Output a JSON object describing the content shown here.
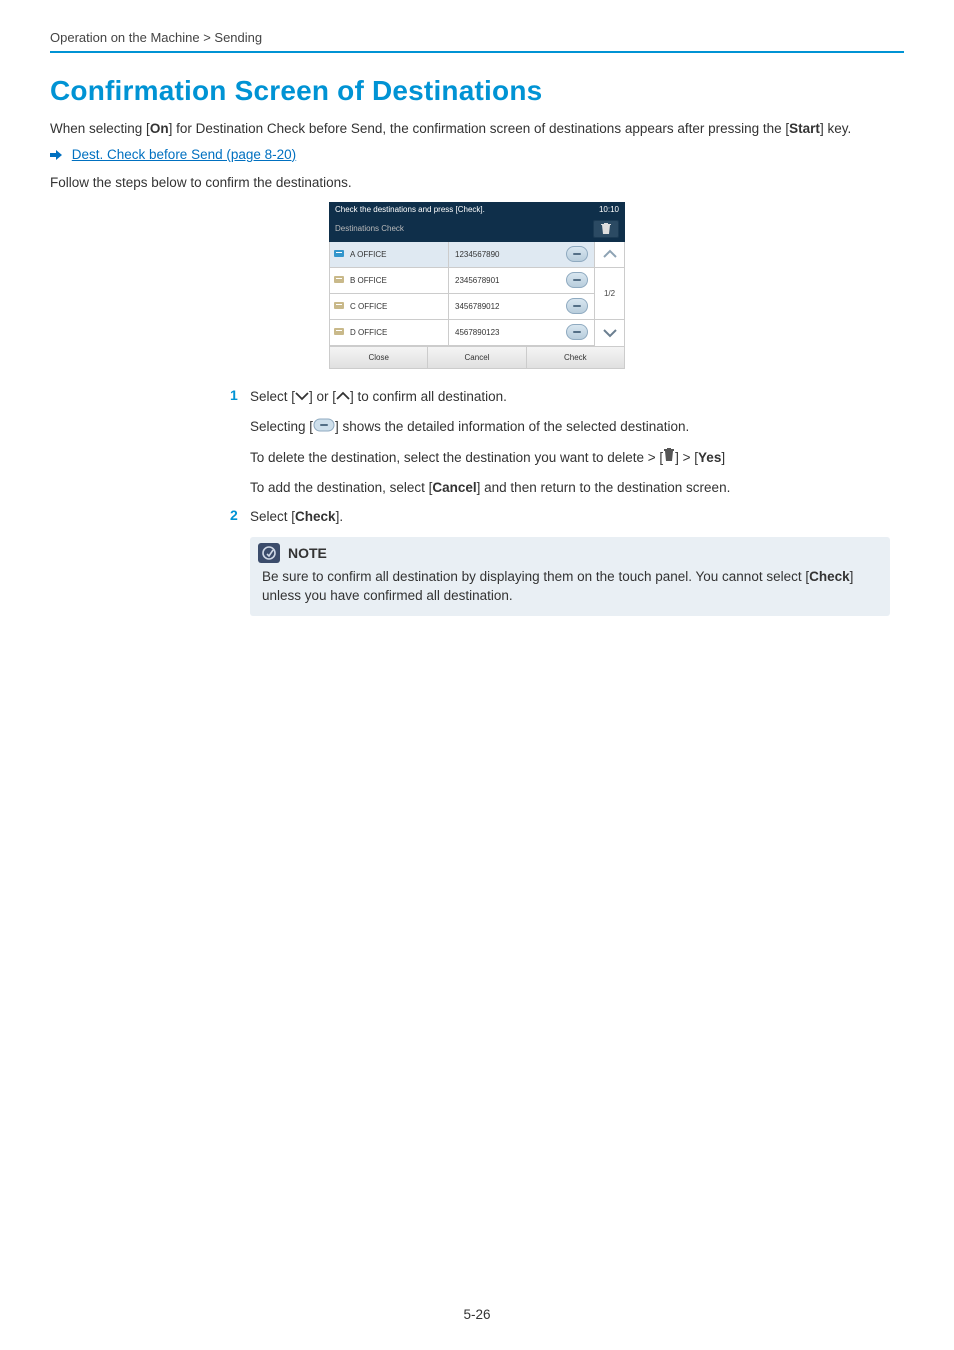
{
  "breadcrumb": "Operation on the Machine > Sending",
  "title": "Confirmation Screen of Destinations",
  "intro_parts": {
    "p1": "When selecting [",
    "on": "On",
    "p2": "] for Destination Check before Send, the confirmation screen of destinations appears after pressing the [",
    "start": "Start",
    "p3": "] key."
  },
  "link_text": "Dest. Check before Send (page 8-20)",
  "follow": "Follow the steps below to confirm the destinations.",
  "panel": {
    "title": "Check the destinations and press [Check].",
    "time": "10:10",
    "subtitle": "Destinations Check",
    "rows": [
      {
        "name": "A OFFICE",
        "num": "1234567890"
      },
      {
        "name": "B OFFICE",
        "num": "2345678901"
      },
      {
        "name": "C OFFICE",
        "num": "3456789012"
      },
      {
        "name": "D OFFICE",
        "num": "4567890123"
      }
    ],
    "page": "1/2",
    "close": "Close",
    "cancel": "Cancel",
    "check": "Check"
  },
  "steps": {
    "s1_a": "Select [",
    "s1_b": "] or [",
    "s1_c": "] to confirm all destination.",
    "s1_sub1_a": "Selecting [",
    "s1_sub1_b": "] shows the detailed information of the selected destination.",
    "s1_sub2_a": "To delete the destination, select the destination you want to delete > [",
    "s1_sub2_b": "] > [",
    "s1_sub2_yes": "Yes",
    "s1_sub2_c": "]",
    "s1_sub3_a": "To add the destination, select [",
    "s1_sub3_cancel": "Cancel",
    "s1_sub3_b": "] and then return to the destination screen.",
    "s2_a": "Select [",
    "s2_check": "Check",
    "s2_b": "]."
  },
  "note": {
    "label": "NOTE",
    "body_a": "Be sure to confirm all destination by displaying them on the touch panel. You cannot select [",
    "body_check": "Check",
    "body_b": "] unless you have confirmed all destination."
  },
  "page_number": "5-26"
}
